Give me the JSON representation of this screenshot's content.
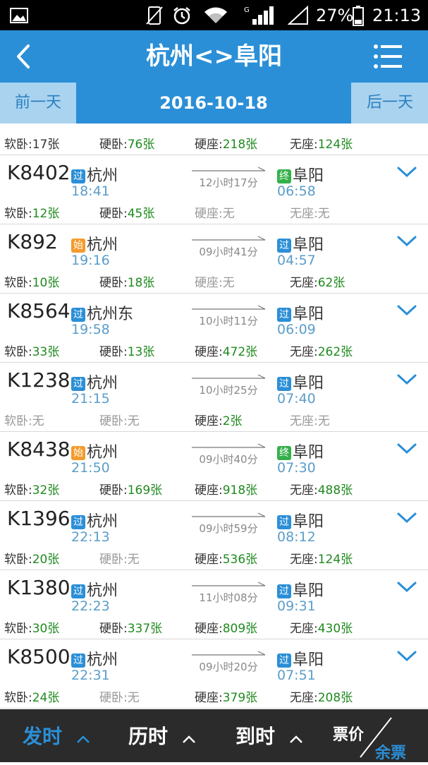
{
  "status_bar": {
    "battery_percent": "27%",
    "time": "21:13",
    "icons": [
      "gallery-icon",
      "no-sim-vibrate-icon",
      "alarm-icon",
      "wifi-icon",
      "signal-icon",
      "signal-empty-icon",
      "battery-icon"
    ]
  },
  "header": {
    "title": "杭州<>阜阳",
    "back_icon": "back-arrow-icon",
    "menu_icon": "menu-icon"
  },
  "date_bar": {
    "prev_label": "前一天",
    "current_date": "2016-10-18",
    "next_label": "后一天"
  },
  "seat_labels": {
    "soft_sleeper": "软卧:",
    "hard_sleeper": "硬卧:",
    "hard_seat": "硬座:",
    "no_seat": "无座:"
  },
  "partial_row": {
    "soft_sleeper": "17张",
    "hard_sleeper": "76张",
    "hard_seat": "218张",
    "no_seat": "124张"
  },
  "trains": [
    {
      "code": "K8402",
      "from_badge": "过",
      "from_badge_type": "pass",
      "from": "杭州",
      "dep_time": "18:41",
      "duration": "12小时17分",
      "to_badge": "终",
      "to_badge_type": "end",
      "to": "阜阳",
      "arr_time": "06:58",
      "soft_sleeper": "12张",
      "hard_sleeper": "45张",
      "hard_seat": "无",
      "no_seat": "无"
    },
    {
      "code": "K892",
      "from_badge": "始",
      "from_badge_type": "start",
      "from": "杭州",
      "dep_time": "19:16",
      "duration": "09小时41分",
      "to_badge": "过",
      "to_badge_type": "pass",
      "to": "阜阳",
      "arr_time": "04:57",
      "soft_sleeper": "10张",
      "hard_sleeper": "18张",
      "hard_seat": "无",
      "no_seat": "62张"
    },
    {
      "code": "K8564",
      "from_badge": "过",
      "from_badge_type": "pass",
      "from": "杭州东",
      "dep_time": "19:58",
      "duration": "10小时11分",
      "to_badge": "过",
      "to_badge_type": "pass",
      "to": "阜阳",
      "arr_time": "06:09",
      "soft_sleeper": "33张",
      "hard_sleeper": "13张",
      "hard_seat": "472张",
      "no_seat": "262张"
    },
    {
      "code": "K1238",
      "from_badge": "过",
      "from_badge_type": "pass",
      "from": "杭州",
      "dep_time": "21:15",
      "duration": "10小时25分",
      "to_badge": "过",
      "to_badge_type": "pass",
      "to": "阜阳",
      "arr_time": "07:40",
      "soft_sleeper": "无",
      "hard_sleeper": "无",
      "hard_seat": "2张",
      "no_seat": "无"
    },
    {
      "code": "K8438",
      "from_badge": "始",
      "from_badge_type": "start",
      "from": "杭州",
      "dep_time": "21:50",
      "duration": "09小时40分",
      "to_badge": "终",
      "to_badge_type": "end",
      "to": "阜阳",
      "arr_time": "07:30",
      "soft_sleeper": "32张",
      "hard_sleeper": "169张",
      "hard_seat": "918张",
      "no_seat": "488张"
    },
    {
      "code": "K1396",
      "from_badge": "过",
      "from_badge_type": "pass",
      "from": "杭州",
      "dep_time": "22:13",
      "duration": "09小时59分",
      "to_badge": "过",
      "to_badge_type": "pass",
      "to": "阜阳",
      "arr_time": "08:12",
      "soft_sleeper": "20张",
      "hard_sleeper": "无",
      "hard_seat": "536张",
      "no_seat": "124张"
    },
    {
      "code": "K1380",
      "from_badge": "过",
      "from_badge_type": "pass",
      "from": "杭州",
      "dep_time": "22:23",
      "duration": "11小时08分",
      "to_badge": "过",
      "to_badge_type": "pass",
      "to": "阜阳",
      "arr_time": "09:31",
      "soft_sleeper": "30张",
      "hard_sleeper": "337张",
      "hard_seat": "809张",
      "no_seat": "430张"
    },
    {
      "code": "K8500",
      "from_badge": "过",
      "from_badge_type": "pass",
      "from": "杭州",
      "dep_time": "22:31",
      "duration": "09小时20分",
      "to_badge": "过",
      "to_badge_type": "pass",
      "to": "阜阳",
      "arr_time": "07:51",
      "soft_sleeper": "24张",
      "hard_sleeper": "无",
      "hard_seat": "379张",
      "no_seat": "208张"
    }
  ],
  "bottom_bar": {
    "sort_departure": "发时",
    "sort_duration": "历时",
    "sort_arrival": "到时",
    "price_label": "票价",
    "remaining_label": "余票",
    "active_sort": "departure"
  },
  "colors": {
    "header_blue": "#2b8fd7",
    "date_bar_light": "#a9d3ef",
    "available_green": "#1f8a1f",
    "unavailable_gray": "#999999",
    "time_blue": "#5b9dc9",
    "badge_pass": "#2b8fd7",
    "badge_start": "#f39b2c",
    "badge_end": "#34b04a",
    "bottom_bar": "#2b2b2b"
  }
}
